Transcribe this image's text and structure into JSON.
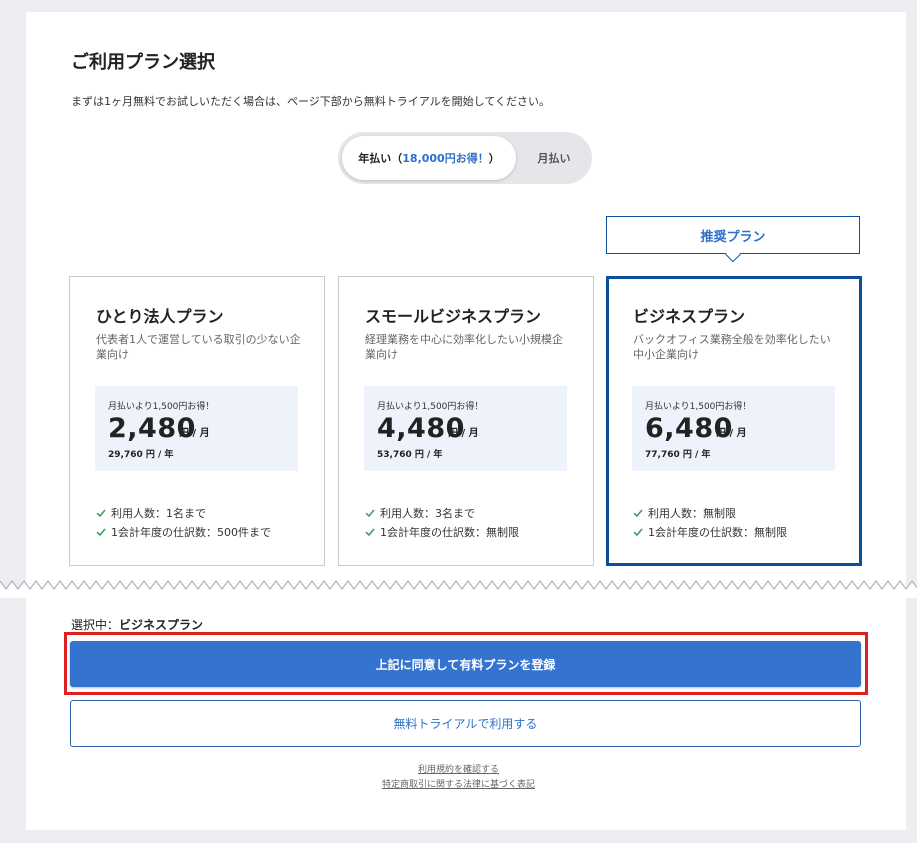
{
  "page": {
    "title": "ご利用プラン選択",
    "subtitle": "まずは1ヶ月無料でお試しいただく場合は、ページ下部から無料トライアルを開始してください。"
  },
  "billing_toggle": {
    "annual_label": "年払い（",
    "annual_highlight": "18,000円お得！",
    "annual_suffix": "）",
    "monthly_label": "月払い",
    "selected": "annual"
  },
  "recommended_tag": "推奨プラン",
  "plans": [
    {
      "name": "ひとり法人プラン",
      "description": "代表者1人で運営している取引の少ない企業向け",
      "savings": "月払いより1,500円お得！",
      "price": "2,480",
      "unit": "円 / 月",
      "yearly": "29,760 円 / 年",
      "features": [
        "利用人数：1名まで",
        "1会計年度の仕訳数：500件まで"
      ]
    },
    {
      "name": "スモールビジネスプラン",
      "description": "経理業務を中心に効率化したい小規模企業向け",
      "savings": "月払いより1,500円お得！",
      "price": "4,480",
      "unit": "円 / 月",
      "yearly": "53,760 円 / 年",
      "features": [
        "利用人数：3名まで",
        "1会計年度の仕訳数：無制限"
      ]
    },
    {
      "name": "ビジネスプラン",
      "description": "バックオフィス業務全般を効率化したい中小企業向け",
      "savings": "月払いより1,500円お得！",
      "price": "6,480",
      "unit": "円 / 月",
      "yearly": "77,760 円 / 年",
      "features": [
        "利用人数：無制限",
        "1会計年度の仕訳数：無制限"
      ],
      "selected": true
    }
  ],
  "selection": {
    "prefix": "選択中：",
    "plan_name": "ビジネスプラン"
  },
  "actions": {
    "register_label": "上記に同意して有料プランを登録",
    "trial_label": "無料トライアルで利用する"
  },
  "links": {
    "terms": "利用規約を確認する",
    "legal": "特定商取引に関する法律に基づく表記"
  },
  "colors": {
    "accent": "#3573d0",
    "selected_border": "#0d4f9c",
    "highlight_outline": "#e01f1f",
    "check": "#3aa15a",
    "price_box": "#eef2fb"
  }
}
